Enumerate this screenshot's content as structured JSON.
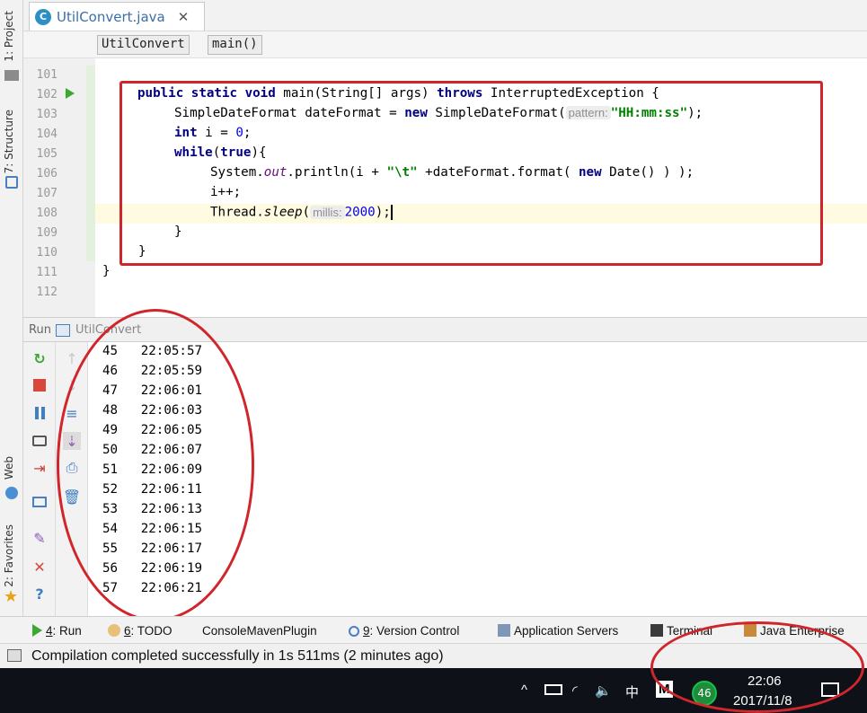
{
  "left_strip": {
    "project": "1: Project",
    "structure": "7: Structure",
    "web": "Web",
    "favorites": "2: Favorites"
  },
  "editor_tab": {
    "file_name": "UtilConvert.java",
    "close": "✕"
  },
  "breadcrumb": [
    "UtilConvert",
    "main()"
  ],
  "line_numbers": [
    "101",
    "102",
    "103",
    "104",
    "105",
    "106",
    "107",
    "108",
    "109",
    "110",
    "111",
    "112"
  ],
  "code": {
    "l102_a": "public static void",
    "l102_b": " main(String[] args) ",
    "l102_c": "throws",
    "l102_d": " InterruptedException {",
    "l103_a": "SimpleDateFormat dateFormat = ",
    "l103_b": "new",
    "l103_c": " SimpleDateFormat(",
    "l103_hint": "pattern:",
    "l103_str": "\"HH:mm:ss\"",
    "l103_d": ");",
    "l104_a": "int",
    "l104_b": " i = ",
    "l104_num": "0",
    "l104_c": ";",
    "l105_a": "while",
    "l105_b": "(",
    "l105_c": "true",
    "l105_d": "){",
    "l106_a": "System.",
    "l106_out": "out",
    "l106_b": ".println(i + ",
    "l106_str": "\"\\t\"",
    "l106_c": " +dateFormat.format( ",
    "l106_new": "new",
    "l106_d": " Date() ) );",
    "l107": "i++;",
    "l108_a": "Thread.",
    "l108_sleep": "sleep",
    "l108_b": "(",
    "l108_hint": "millis:",
    "l108_num": "2000",
    "l108_c": ");",
    "l109": "}",
    "l110": "}",
    "l111": "}"
  },
  "run_panel": {
    "label": "Run",
    "config": "UtilConvert"
  },
  "console_lines": [
    "45   22:05:57",
    "46   22:05:59",
    "47   22:06:01",
    "48   22:06:03",
    "49   22:06:05",
    "50   22:06:07",
    "51   22:06:09",
    "52   22:06:11",
    "53   22:06:13",
    "54   22:06:15",
    "55   22:06:17",
    "56   22:06:19",
    "57   22:06:21"
  ],
  "bottom_tabs": {
    "run_num": "4",
    "run": ": Run",
    "todo_num": "6",
    "todo": ": TODO",
    "maven": "ConsoleMavenPlugin",
    "vc_num": "9",
    "vc": ": Version Control",
    "app_servers": "Application Servers",
    "terminal": "Terminal",
    "java_ee": "Java Enterprise"
  },
  "status": {
    "text": "Compilation completed successfully in 1s 511ms (2 minutes ago)"
  },
  "taskbar": {
    "chevron": "^",
    "ime": "中",
    "m_icon": "M",
    "badge": "46",
    "time": "22:06",
    "date": "2017/11/8"
  },
  "colors": {
    "annotation_red": "#d0262b",
    "keyword": "#000080",
    "string": "#008000",
    "number": "#0000ff"
  }
}
